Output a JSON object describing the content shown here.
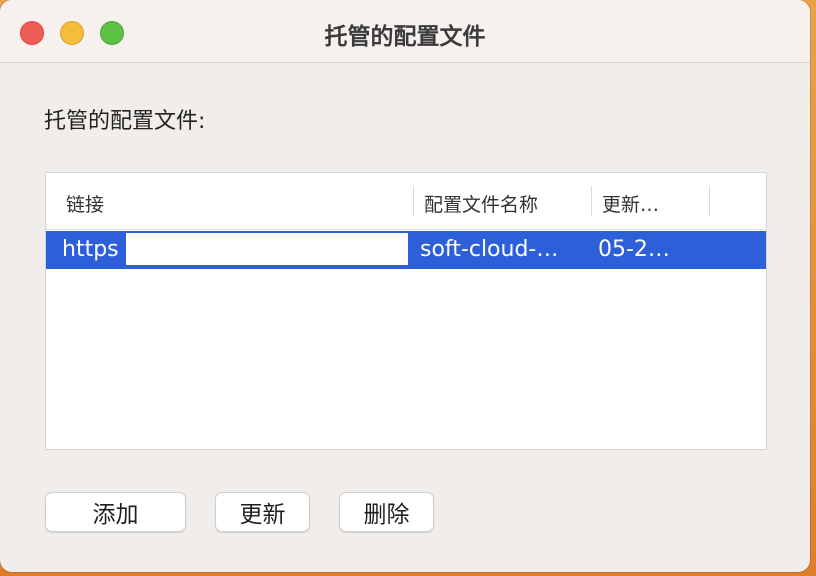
{
  "window": {
    "title": "托管的配置文件"
  },
  "section_label": "托管的配置文件:",
  "table": {
    "columns": [
      "链接",
      "配置文件名称",
      "更新…"
    ],
    "rows": [
      {
        "link": "https",
        "profile_name": "soft-cloud-…",
        "updated": "05-2…"
      }
    ]
  },
  "buttons": {
    "add": "添加",
    "update": "更新",
    "delete": "删除"
  },
  "colors": {
    "selection": "#2c5fd8",
    "close": "#ee5e56",
    "minimize": "#f5bd3c",
    "maximize": "#5ec145"
  }
}
